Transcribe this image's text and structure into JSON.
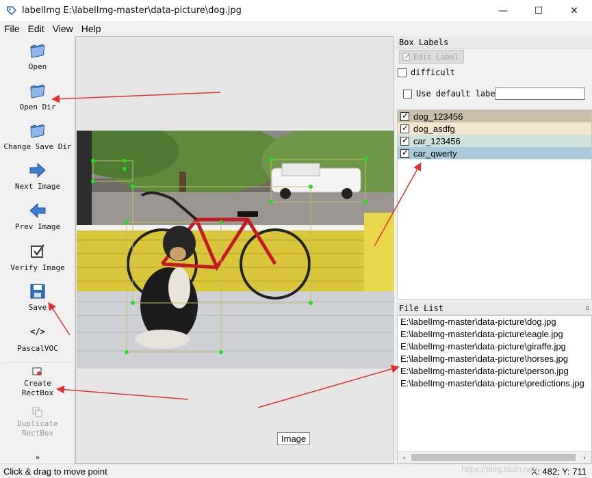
{
  "window": {
    "title": "labelImg E:\\labelImg-master\\data-picture\\dog.jpg",
    "app_icon": "tag-icon",
    "controls": {
      "minimize": "—",
      "maximize": "☐",
      "close": "✕"
    }
  },
  "menu": {
    "items": [
      "File",
      "Edit",
      "View",
      "Help"
    ]
  },
  "toolbar": {
    "items": [
      {
        "label": "Open",
        "icon": "folder-open-icon",
        "enabled": true
      },
      {
        "label": "Open Dir",
        "icon": "folder-open-icon",
        "enabled": true
      },
      {
        "label": "Change Save Dir",
        "icon": "folder-open-icon",
        "enabled": true
      },
      {
        "label": "Next Image",
        "icon": "arrow-right-icon",
        "enabled": true
      },
      {
        "label": "Prev Image",
        "icon": "arrow-left-icon",
        "enabled": true
      },
      {
        "label": "Verify Image",
        "icon": "checkbox-icon",
        "enabled": true
      },
      {
        "label": "Save",
        "icon": "floppy-disk-icon",
        "enabled": true
      },
      {
        "label": "PascalVOC",
        "icon": "code-icon",
        "enabled": true
      },
      {
        "label": "Create\nRectBox",
        "icon": "rectbox-icon",
        "enabled": true
      },
      {
        "label": "Duplicate\nRectBox",
        "icon": "duplicate-icon",
        "enabled": false
      }
    ],
    "more": "»"
  },
  "canvas": {
    "tooltip": "Image"
  },
  "box_labels": {
    "title": "Box Labels",
    "edit_label": "Edit Label",
    "difficult": "difficult",
    "use_default_label": "Use default label",
    "default_label_value": "",
    "labels": [
      {
        "name": "dog_123456",
        "checked": true,
        "color": "#c9bea8"
      },
      {
        "name": "dog_asdfg",
        "checked": true,
        "color": "#f3e6cd"
      },
      {
        "name": "car_123456",
        "checked": true,
        "color": "#cfe3dc"
      },
      {
        "name": "car_qwerty",
        "checked": true,
        "color": "#a8c9dc"
      }
    ]
  },
  "file_list": {
    "title": "File List",
    "files": [
      "E:\\labelImg-master\\data-picture\\dog.jpg",
      "E:\\labelImg-master\\data-picture\\eagle.jpg",
      "E:\\labelImg-master\\data-picture\\giraffe.jpg",
      "E:\\labelImg-master\\data-picture\\horses.jpg",
      "E:\\labelImg-master\\data-picture\\person.jpg",
      "E:\\labelImg-master\\data-picture\\predictions.jpg"
    ]
  },
  "status": {
    "message": "Click & drag to move point",
    "coords": "X: 482; Y: 711",
    "watermark": "https://blog.csdn.net/"
  },
  "colors": {
    "annotation_arrow": "#e03030",
    "box_point": "#22dd22",
    "box_line": "#bfbf6a"
  }
}
